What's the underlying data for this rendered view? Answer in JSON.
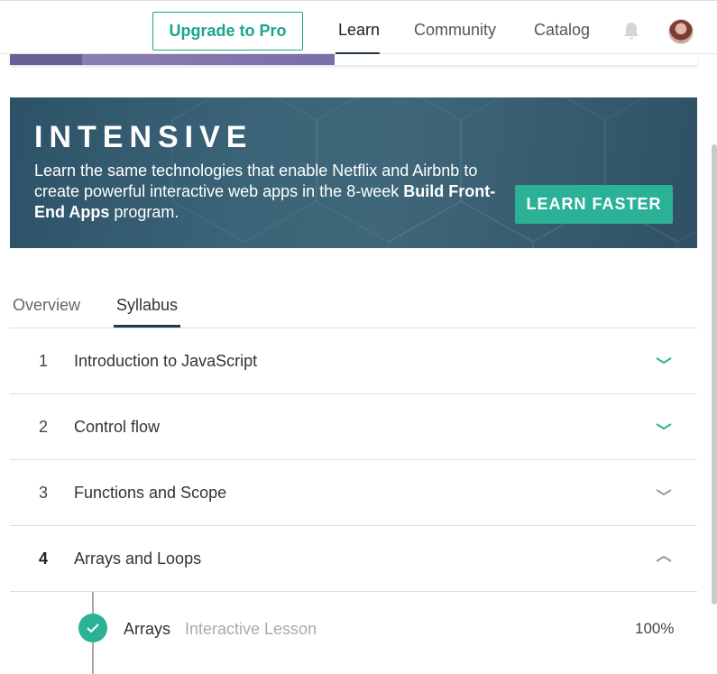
{
  "nav": {
    "upgrade_label": "Upgrade to Pro",
    "links": [
      "Learn",
      "Community",
      "Catalog"
    ],
    "active": "Learn",
    "bell_icon": "bell-icon",
    "avatar_icon": "user-avatar"
  },
  "banner": {
    "logo": "INTENSIVE",
    "text_plain": "Learn the same technologies that enable Netflix and Airbnb to create powerful interactive web apps in the 8-week ",
    "text_bold": "Build Front-End Apps",
    "text_end": " program.",
    "button_label": "LEARN FASTER"
  },
  "tabs": {
    "items": [
      "Overview",
      "Syllabus"
    ],
    "active": "Syllabus"
  },
  "syllabus": {
    "units": [
      {
        "number": "1",
        "title": "Introduction to JavaScript",
        "expanded": false
      },
      {
        "number": "2",
        "title": "Control flow",
        "expanded": false
      },
      {
        "number": "3",
        "title": "Functions and Scope",
        "expanded": false
      },
      {
        "number": "4",
        "title": "Arrays and Loops",
        "expanded": true
      }
    ],
    "lessons": [
      {
        "title": "Arrays",
        "type": "Interactive Lesson",
        "progress": "100%",
        "completed": true
      }
    ]
  },
  "colors": {
    "accent": "#2bb196",
    "nav_underline": "#1f3a4a",
    "banner_bg": "#3b6478",
    "course_progress": "#8e83b5"
  }
}
